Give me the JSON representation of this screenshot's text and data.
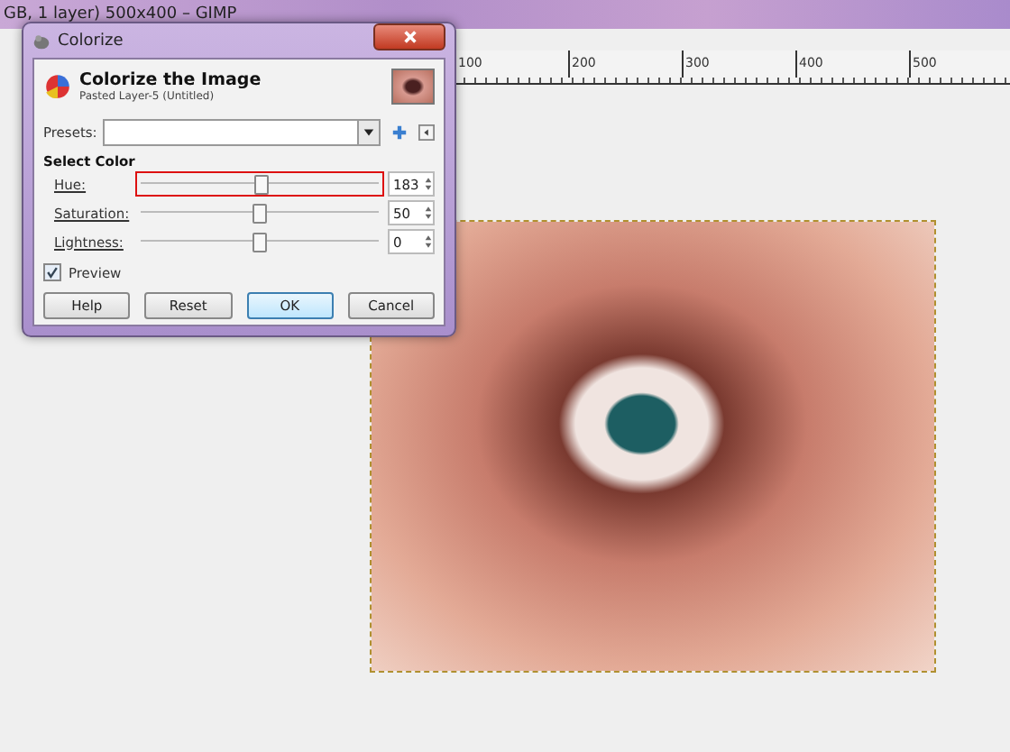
{
  "app_title": "GB, 1 layer) 500x400 – GIMP",
  "ruler": {
    "labels": [
      "100",
      "200",
      "300",
      "400",
      "500"
    ]
  },
  "dialog": {
    "title": "Colorize",
    "heading": "Colorize the Image",
    "subheading": "Pasted Layer-5 (Untitled)",
    "presets": {
      "label": "Presets:"
    },
    "section": "Select Color",
    "sliders": [
      {
        "label": "Hue:",
        "level": 0.51,
        "value": "183",
        "highlighted": true
      },
      {
        "label": "Saturation:",
        "level": 0.5,
        "value": "50",
        "highlighted": false
      },
      {
        "label": "Lightness:",
        "level": 0.5,
        "value": "0",
        "highlighted": false
      }
    ],
    "preview": {
      "label": "Preview",
      "checked": true
    },
    "buttons": [
      {
        "label": "Help",
        "selected": false
      },
      {
        "label": "Reset",
        "selected": false
      },
      {
        "label": "OK",
        "selected": true
      },
      {
        "label": "Cancel",
        "selected": false
      }
    ]
  }
}
